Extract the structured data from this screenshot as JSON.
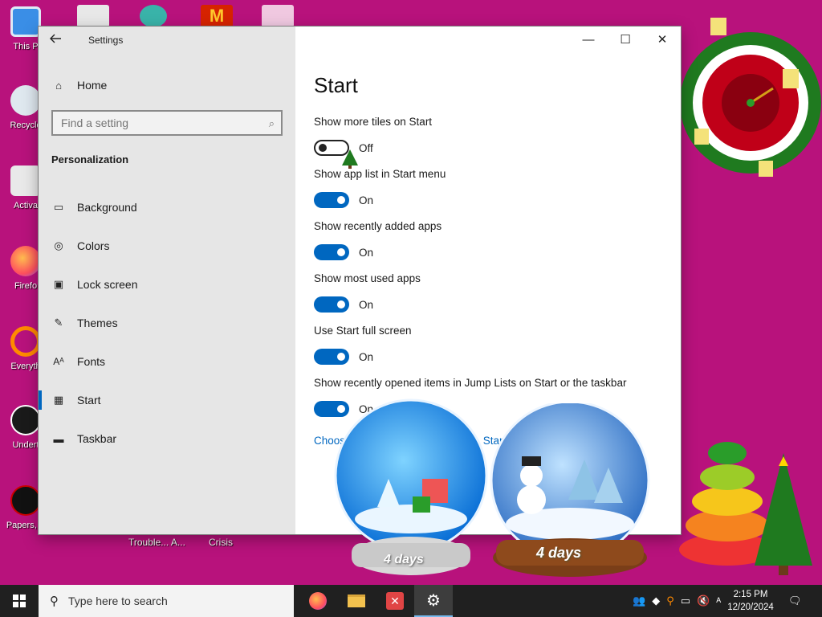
{
  "desktop": {
    "icons": [
      {
        "label": "This P"
      },
      {
        "label": "Recycle"
      },
      {
        "label": "Activa"
      },
      {
        "label": "Firefo"
      },
      {
        "label": "Everyth"
      },
      {
        "label": "Undert"
      },
      {
        "label": "Papers, P"
      }
    ],
    "bottom_labels": [
      "Trouble... A...",
      "Crisis"
    ],
    "globe_left_text": "4 days",
    "globe_right_text": "4 days"
  },
  "window": {
    "title": "Settings",
    "home_label": "Home",
    "search_placeholder": "Find a setting",
    "section": "Personalization",
    "nav": [
      {
        "label": "Background",
        "icon": "image-icon"
      },
      {
        "label": "Colors",
        "icon": "palette-icon"
      },
      {
        "label": "Lock screen",
        "icon": "lock-screen-icon"
      },
      {
        "label": "Themes",
        "icon": "themes-icon"
      },
      {
        "label": "Fonts",
        "icon": "fonts-icon"
      },
      {
        "label": "Start",
        "icon": "start-icon"
      },
      {
        "label": "Taskbar",
        "icon": "taskbar-icon"
      }
    ],
    "controls": {
      "minimize": "—",
      "maximize": "☐",
      "close": "✕"
    }
  },
  "content": {
    "title": "Start",
    "settings": [
      {
        "name": "Show more tiles on Start",
        "state": "Off",
        "on": false
      },
      {
        "name": "Show app list in Start menu",
        "state": "On",
        "on": true
      },
      {
        "name": "Show recently added apps",
        "state": "On",
        "on": true
      },
      {
        "name": "Show most used apps",
        "state": "On",
        "on": true
      },
      {
        "name": "Use Start full screen",
        "state": "On",
        "on": true
      },
      {
        "name": "Show recently opened items in Jump Lists on Start or the taskbar",
        "state": "On",
        "on": true
      }
    ],
    "link_left": "Choos",
    "link_right": "Start"
  },
  "taskbar": {
    "search_placeholder": "Type here to search",
    "time": "2:15 PM",
    "date": "12/20/2024",
    "accent": "#0067c0"
  }
}
